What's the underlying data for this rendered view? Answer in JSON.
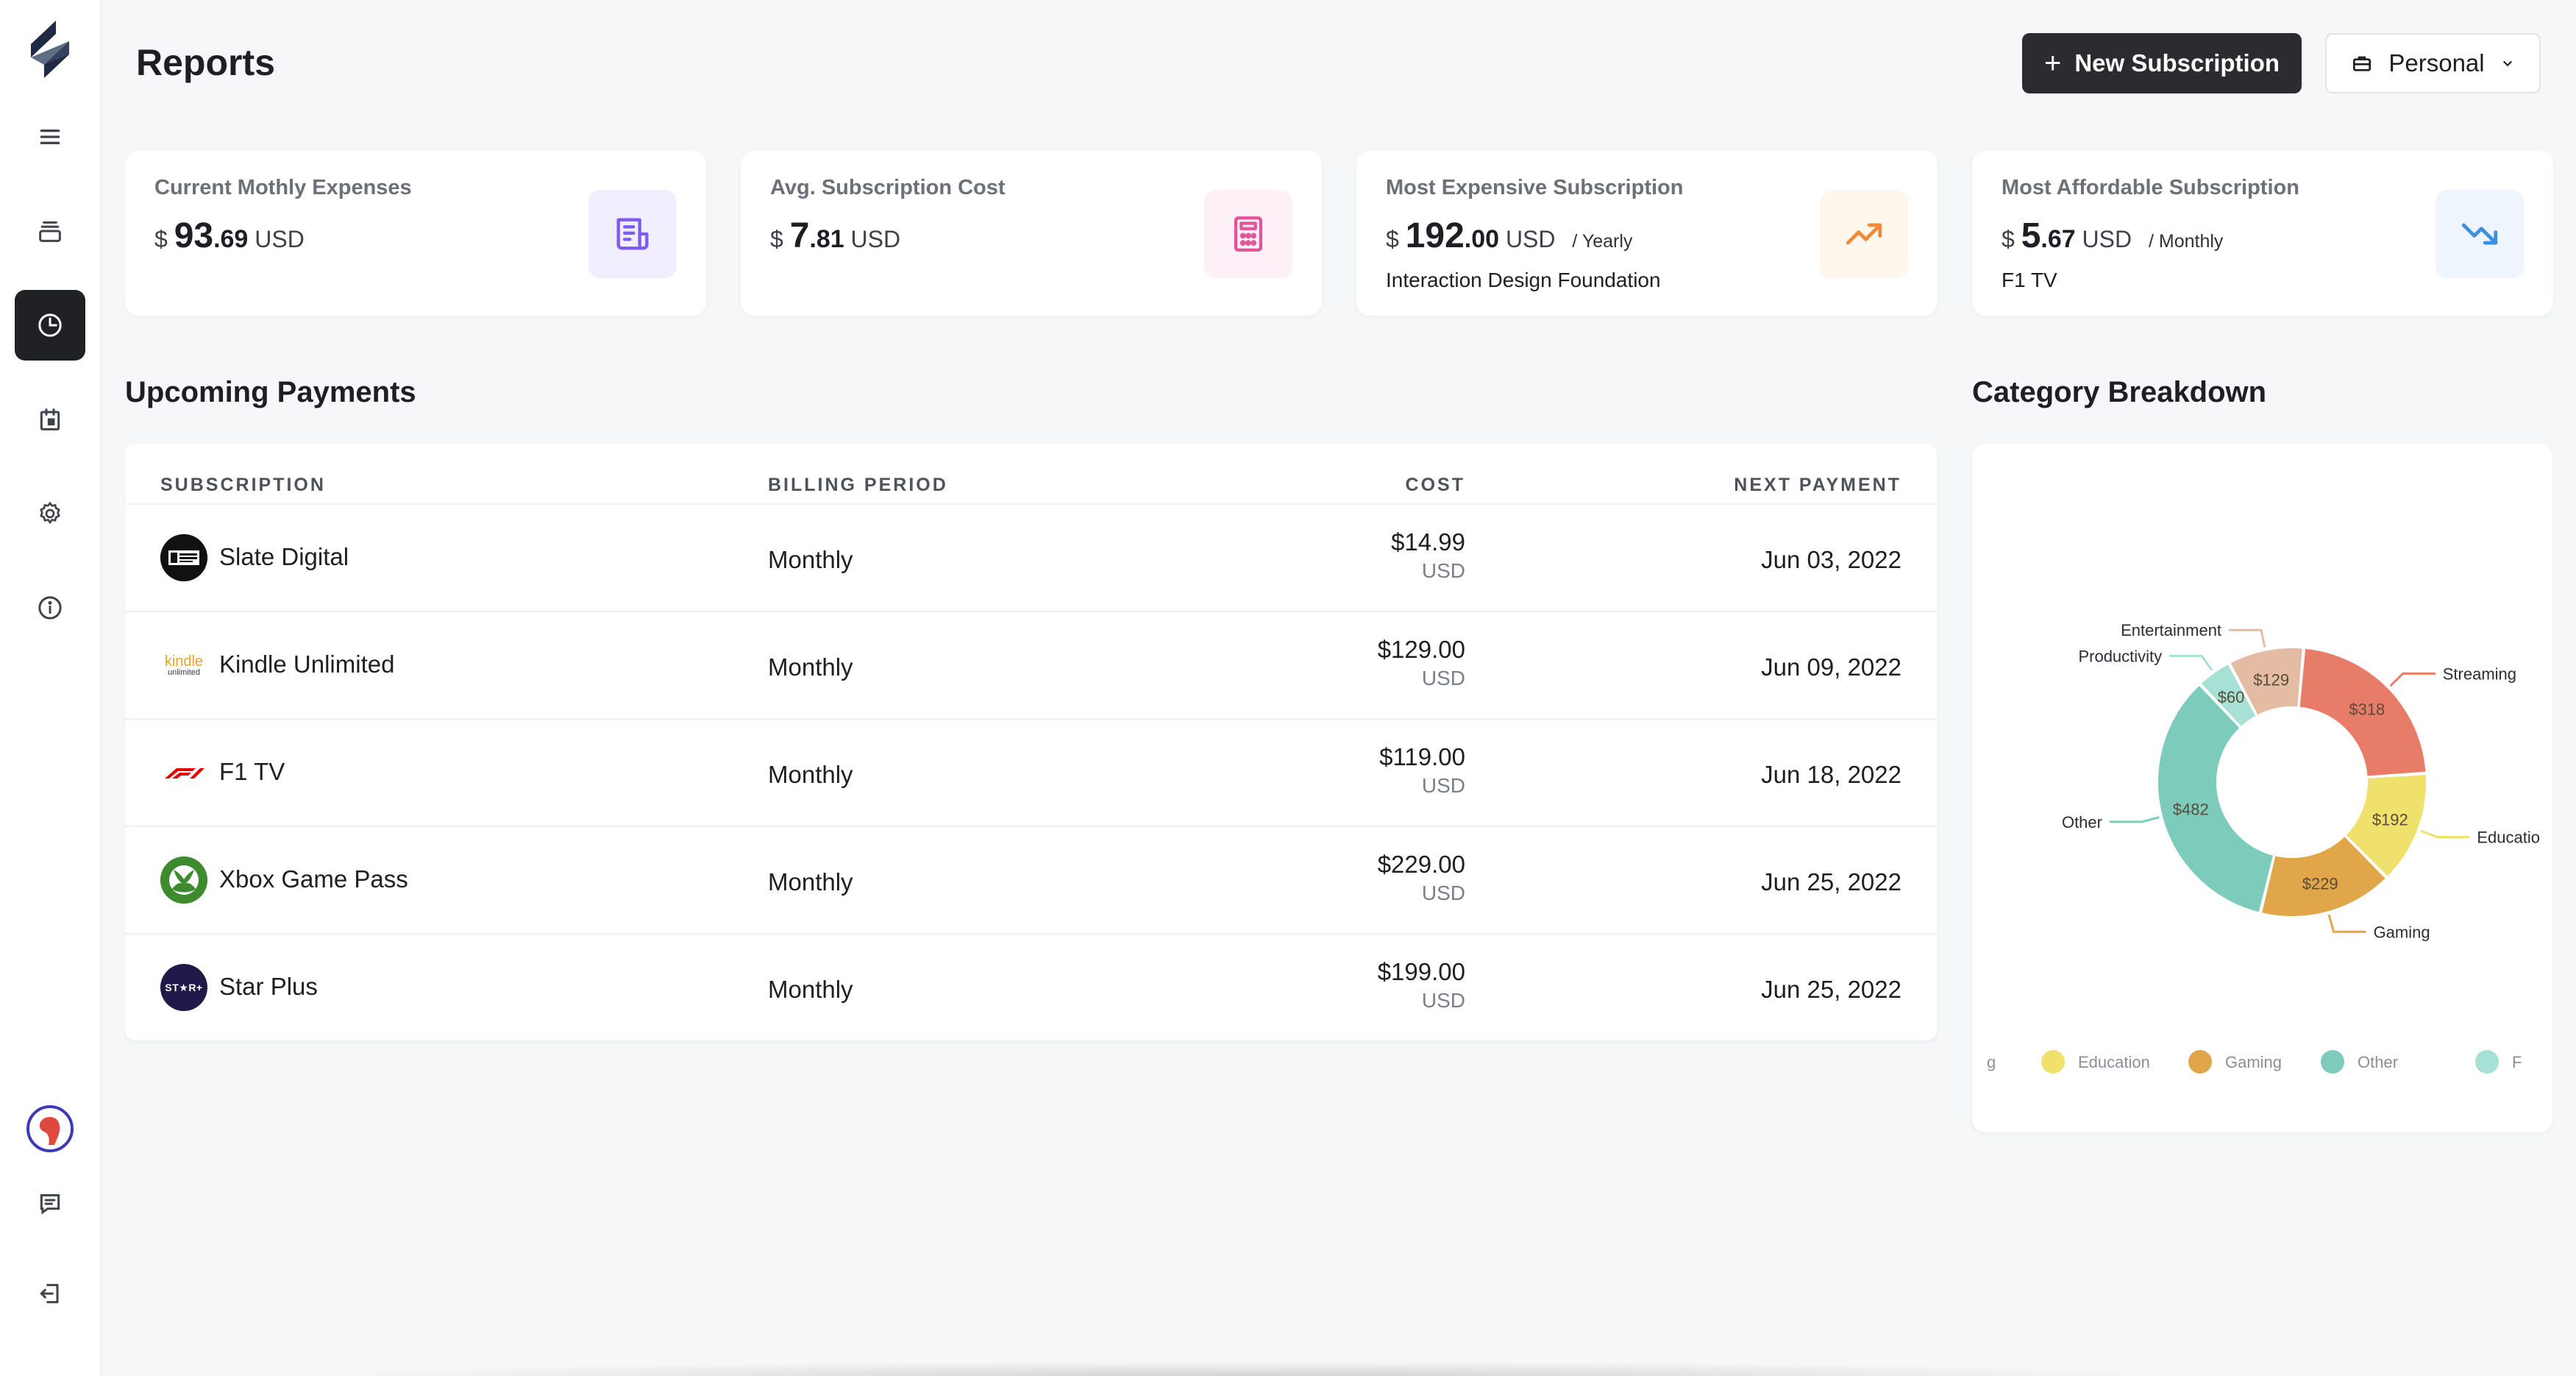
{
  "header": {
    "title": "Reports",
    "new_subscription_label": "New Subscription",
    "workspace_label": "Personal"
  },
  "stats": [
    {
      "label": "Current Mothly Expenses",
      "currency_symbol": "$",
      "whole": "93",
      "decimal": ".69",
      "currency": "USD",
      "period": "",
      "subtitle": "",
      "icon": "receipt-icon",
      "icon_color": "#7f5af0",
      "icon_bg": "#f1efff"
    },
    {
      "label": "Avg. Subscription Cost",
      "currency_symbol": "$",
      "whole": "7",
      "decimal": ".81",
      "currency": "USD",
      "period": "",
      "subtitle": "",
      "icon": "calculator-icon",
      "icon_color": "#e0569a",
      "icon_bg": "#fdf0f6"
    },
    {
      "label": "Most Expensive Subscription",
      "currency_symbol": "$",
      "whole": "192",
      "decimal": ".00",
      "currency": "USD",
      "period": "/ Yearly",
      "subtitle": "Interaction Design Foundation",
      "icon": "trending-up-icon",
      "icon_color": "#ef8a3c",
      "icon_bg": "#fff6ec"
    },
    {
      "label": "Most Affordable Subscription",
      "currency_symbol": "$",
      "whole": "5",
      "decimal": ".67",
      "currency": "USD",
      "period": "/ Monthly",
      "subtitle": "F1 TV",
      "icon": "trending-down-icon",
      "icon_color": "#3d8fe0",
      "icon_bg": "#eef5fd"
    }
  ],
  "upcoming": {
    "title": "Upcoming Payments",
    "columns": [
      "SUBSCRIPTION",
      "BILLING PERIOD",
      "COST",
      "NEXT PAYMENT"
    ],
    "rows": [
      {
        "name": "Slate Digital",
        "billing": "Monthly",
        "cost": "$14.99",
        "unit": "USD",
        "next": "Jun 03, 2022",
        "logo": "slate-digital-logo"
      },
      {
        "name": "Kindle Unlimited",
        "billing": "Monthly",
        "cost": "$129.00",
        "unit": "USD",
        "next": "Jun 09, 2022",
        "logo": "kindle-logo",
        "logo_text_top": "kindle",
        "logo_text_bottom": "unlimited"
      },
      {
        "name": "F1 TV",
        "billing": "Monthly",
        "cost": "$119.00",
        "unit": "USD",
        "next": "Jun 18, 2022",
        "logo": "f1-logo"
      },
      {
        "name": "Xbox Game Pass",
        "billing": "Monthly",
        "cost": "$229.00",
        "unit": "USD",
        "next": "Jun 25, 2022",
        "logo": "xbox-logo"
      },
      {
        "name": "Star Plus",
        "billing": "Monthly",
        "cost": "$199.00",
        "unit": "USD",
        "next": "Jun 25, 2022",
        "logo": "star-plus-logo",
        "logo_text": "ST★R+"
      }
    ]
  },
  "chart_data": {
    "type": "pie",
    "title": "Category Breakdown",
    "categories": [
      "Streaming",
      "Education",
      "Gaming",
      "Other",
      "Productivity",
      "Entertainment"
    ],
    "values": [
      318,
      192,
      229,
      482,
      60,
      129
    ],
    "data_labels": [
      "$318",
      "$192",
      "$229",
      "$482",
      "$60",
      "$129"
    ],
    "callout_labels": [
      "Streaming",
      "Educatio",
      "Gaming",
      "Other",
      "Productivity",
      "Entertainment"
    ],
    "colors": [
      "#e77d68",
      "#f0e16c",
      "#e2a64a",
      "#7ccbbb",
      "#a7e0d4",
      "#e4bca3"
    ],
    "legend": {
      "placement": "bottom",
      "items": [
        "g",
        "Education",
        "Gaming",
        "Other",
        "F"
      ],
      "colors": [
        "#e77d68",
        "#f0e16c",
        "#e2a64a",
        "#7ccbbb",
        "#a7e0d4"
      ]
    }
  },
  "sidebar": {
    "items": [
      {
        "name": "menu",
        "icon": "menu-icon"
      },
      {
        "name": "subscriptions",
        "icon": "stack-icon"
      },
      {
        "name": "reports",
        "icon": "pie-chart-icon",
        "active": true
      },
      {
        "name": "calendar",
        "icon": "calendar-icon"
      },
      {
        "name": "settings",
        "icon": "gear-icon"
      },
      {
        "name": "info",
        "icon": "info-icon"
      },
      {
        "name": "feedback",
        "icon": "message-icon"
      },
      {
        "name": "logout",
        "icon": "logout-icon"
      }
    ]
  }
}
